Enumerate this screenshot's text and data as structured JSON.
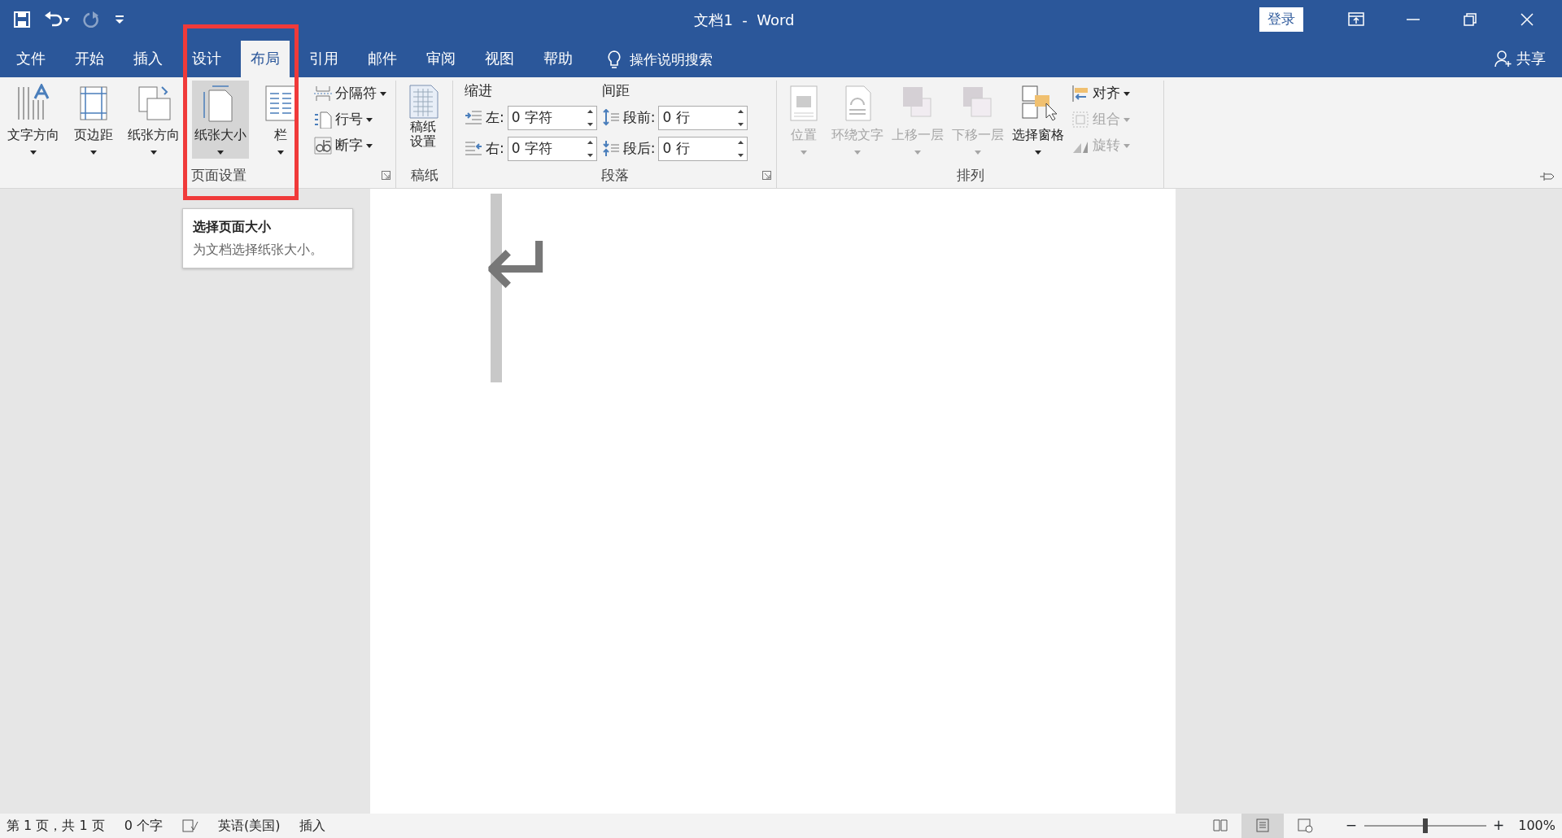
{
  "window": {
    "title": "文档1  -  Word",
    "sign_in": "登录"
  },
  "quick_access": [
    {
      "kind": "save",
      "disabled": false
    },
    {
      "kind": "undo",
      "disabled": false
    },
    {
      "kind": "redo",
      "disabled": true
    },
    {
      "kind": "customize",
      "disabled": false
    }
  ],
  "tabs": [
    {
      "label": "文件",
      "selected": false
    },
    {
      "label": "开始",
      "selected": false
    },
    {
      "label": "插入",
      "selected": false
    },
    {
      "label": "设计",
      "selected": false
    },
    {
      "label": "布局",
      "selected": true
    },
    {
      "label": "引用",
      "selected": false
    },
    {
      "label": "邮件",
      "selected": false
    },
    {
      "label": "审阅",
      "selected": false
    },
    {
      "label": "视图",
      "selected": false
    },
    {
      "label": "帮助",
      "selected": false
    }
  ],
  "tell_me": {
    "placeholder": "操作说明搜索"
  },
  "share": "共享",
  "page_setup": {
    "label": "页面设置",
    "large_buttons": [
      {
        "label": "文字方向",
        "kind": "text_direction",
        "pressed": false
      },
      {
        "label": "页边距",
        "kind": "margins",
        "pressed": false
      },
      {
        "label": "纸张方向",
        "kind": "orientation",
        "pressed": false
      },
      {
        "label": "纸张大小",
        "kind": "size",
        "pressed": true
      },
      {
        "label": "栏",
        "kind": "columns",
        "pressed": false
      }
    ],
    "small_buttons": [
      {
        "label": "分隔符",
        "kind": "breaks"
      },
      {
        "label": "行号",
        "kind": "line_numbers"
      },
      {
        "label": "断字",
        "kind": "hyphenation"
      }
    ]
  },
  "manuscript": {
    "label": "稿纸",
    "button_lines": [
      "稿纸",
      "设置"
    ]
  },
  "paragraph": {
    "label": "段落",
    "indent_title": "缩进",
    "spacing_title": "间距",
    "fields": [
      {
        "label": "左:",
        "value": "0 字符",
        "kind": "indent_left"
      },
      {
        "label": "段前:",
        "value": "0 行",
        "kind": "space_before"
      },
      {
        "label": "右:",
        "value": "0 字符",
        "kind": "indent_right"
      },
      {
        "label": "段后:",
        "value": "0 行",
        "kind": "space_after"
      }
    ]
  },
  "arrange": {
    "label": "排列",
    "large_buttons": [
      {
        "label": "位置",
        "kind": "position",
        "disabled": true
      },
      {
        "label": "环绕文字",
        "kind": "wrap",
        "disabled": true
      },
      {
        "label": "上移一层",
        "kind": "forward",
        "disabled": true
      },
      {
        "label": "下移一层",
        "kind": "backward",
        "disabled": true
      },
      {
        "label": "选择窗格",
        "kind": "pane",
        "disabled": false
      }
    ],
    "small_buttons": [
      {
        "label": "对齐",
        "kind": "align",
        "disabled": false
      },
      {
        "label": "组合",
        "kind": "group",
        "disabled": true
      },
      {
        "label": "旋转",
        "kind": "rotate",
        "disabled": true
      }
    ]
  },
  "tooltip": {
    "title": "选择页面大小",
    "text": "为文档选择纸张大小。"
  },
  "document": {
    "paragraph_mark": "↵"
  },
  "status_bar": {
    "items": [
      "第 1 页，共 1 页",
      "0 个字",
      "英语(美国)",
      "插入"
    ],
    "views": [
      {
        "kind": "read",
        "selected": false
      },
      {
        "kind": "print",
        "selected": true
      },
      {
        "kind": "web",
        "selected": false
      }
    ],
    "zoom_minus": "−",
    "zoom_plus": "+",
    "zoom": {
      "level": 0.5
    },
    "zoom_text": "100%"
  }
}
